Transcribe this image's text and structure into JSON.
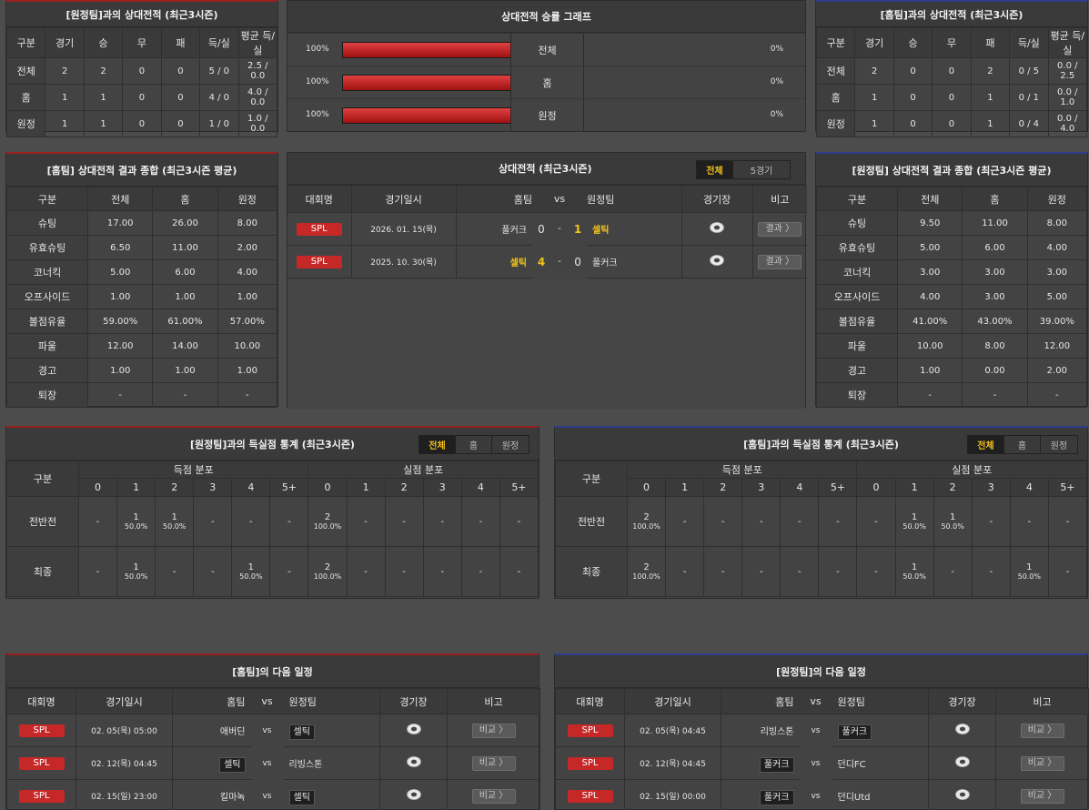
{
  "colors": {
    "accent_red": "#c62828",
    "highlight_yellow": "#f2c21a",
    "home_border": "#9a1f1f",
    "away_border": "#2d3d8a"
  },
  "h2h_left": {
    "title": "[원정팀]과의 상대전적 (최근3시즌)",
    "headers": [
      "구분",
      "경기",
      "승",
      "무",
      "패",
      "득/실",
      "평균 득/실"
    ],
    "rows": [
      [
        "전체",
        "2",
        "2",
        "0",
        "0",
        "5 / 0",
        "2.5 / 0.0"
      ],
      [
        "홈",
        "1",
        "1",
        "0",
        "0",
        "4 / 0",
        "4.0 / 0.0"
      ],
      [
        "원정",
        "1",
        "1",
        "0",
        "0",
        "1 / 0",
        "1.0 / 0.0"
      ]
    ]
  },
  "graph": {
    "title": "상대전적 승률 그래프",
    "rows": [
      {
        "left": "100%",
        "label": "전체",
        "right": "0%",
        "value": 1.0
      },
      {
        "left": "100%",
        "label": "홈",
        "right": "0%",
        "value": 1.0
      },
      {
        "left": "100%",
        "label": "원정",
        "right": "0%",
        "value": 1.0
      }
    ]
  },
  "h2h_right": {
    "title": "[홈팀]과의 상대전적 (최근3시즌)",
    "headers": [
      "구분",
      "경기",
      "승",
      "무",
      "패",
      "득/실",
      "평균 득/실"
    ],
    "rows": [
      [
        "전체",
        "2",
        "0",
        "0",
        "2",
        "0 / 5",
        "0.0 / 2.5"
      ],
      [
        "홈",
        "1",
        "0",
        "0",
        "1",
        "0 / 1",
        "0.0 / 1.0"
      ],
      [
        "원정",
        "1",
        "0",
        "0",
        "1",
        "0 / 4",
        "0.0 / 4.0"
      ]
    ]
  },
  "summary_home": {
    "title": "[홈팀] 상대전적 결과 종합 (최근3시즌 평균)",
    "headers": [
      "구분",
      "전체",
      "홈",
      "원정"
    ],
    "rows": [
      [
        "슈팅",
        "17.00",
        "26.00",
        "8.00"
      ],
      [
        "유효슈팅",
        "6.50",
        "11.00",
        "2.00"
      ],
      [
        "코너킥",
        "5.00",
        "6.00",
        "4.00"
      ],
      [
        "오프사이드",
        "1.00",
        "1.00",
        "1.00"
      ],
      [
        "볼점유율",
        "59.00%",
        "61.00%",
        "57.00%"
      ],
      [
        "파울",
        "12.00",
        "14.00",
        "10.00"
      ],
      [
        "경고",
        "1.00",
        "1.00",
        "1.00"
      ],
      [
        "퇴장",
        "-",
        "-",
        "-"
      ]
    ]
  },
  "h2h_matches": {
    "title": "상대전적 (최근3시즌)",
    "tabs": [
      "전체",
      "5경기"
    ],
    "headers": {
      "league": "대회명",
      "date": "경기일시",
      "home": "홈팀",
      "vs": "vs",
      "away": "원정팀",
      "stadium": "경기장",
      "note": "비고"
    },
    "rows": [
      {
        "league": "SPL",
        "date": "2026. 01. 15(목)",
        "home": "풀커크",
        "hs": "0",
        "sep": "-",
        "as": "1",
        "away": "셀틱",
        "btn": "결과 〉"
      },
      {
        "league": "SPL",
        "date": "2025. 10. 30(목)",
        "home": "셀틱",
        "hs": "4",
        "sep": "-",
        "as": "0",
        "away": "풀커크",
        "btn": "결과 〉"
      }
    ]
  },
  "summary_away": {
    "title": "[원정팀] 상대전적 결과 종합 (최근3시즌 평균)",
    "headers": [
      "구분",
      "전체",
      "홈",
      "원정"
    ],
    "rows": [
      [
        "슈팅",
        "9.50",
        "11.00",
        "8.00"
      ],
      [
        "유효슈팅",
        "5.00",
        "6.00",
        "4.00"
      ],
      [
        "코너킥",
        "3.00",
        "3.00",
        "3.00"
      ],
      [
        "오프사이드",
        "4.00",
        "3.00",
        "5.00"
      ],
      [
        "볼점유율",
        "41.00%",
        "43.00%",
        "39.00%"
      ],
      [
        "파울",
        "10.00",
        "8.00",
        "12.00"
      ],
      [
        "경고",
        "1.00",
        "0.00",
        "2.00"
      ],
      [
        "퇴장",
        "-",
        "-",
        "-"
      ]
    ]
  },
  "goals_left": {
    "title": "[원정팀]과의 득실점 통계 (최근3시즌)",
    "tabs": [
      "전체",
      "홈",
      "원정"
    ],
    "col_label": "구분",
    "for_label": "득점 분포",
    "against_label": "실점 분포",
    "buckets": [
      "0",
      "1",
      "2",
      "3",
      "4",
      "5+"
    ],
    "rows": [
      {
        "label": "전반전",
        "for": [
          [
            "-",
            ""
          ],
          [
            "1",
            "50.0%"
          ],
          [
            "1",
            "50.0%"
          ],
          [
            "-",
            ""
          ],
          [
            "-",
            ""
          ],
          [
            "-",
            ""
          ]
        ],
        "against": [
          [
            "2",
            "100.0%"
          ],
          [
            "-",
            ""
          ],
          [
            "-",
            ""
          ],
          [
            "-",
            ""
          ],
          [
            "-",
            ""
          ],
          [
            "-",
            ""
          ]
        ]
      },
      {
        "label": "최종",
        "for": [
          [
            "-",
            ""
          ],
          [
            "1",
            "50.0%"
          ],
          [
            "-",
            ""
          ],
          [
            "-",
            ""
          ],
          [
            "1",
            "50.0%"
          ],
          [
            "-",
            ""
          ]
        ],
        "against": [
          [
            "2",
            "100.0%"
          ],
          [
            "-",
            ""
          ],
          [
            "-",
            ""
          ],
          [
            "-",
            ""
          ],
          [
            "-",
            ""
          ],
          [
            "-",
            ""
          ]
        ]
      }
    ]
  },
  "goals_right": {
    "title": "[홈팀]과의 득실점 통계 (최근3시즌)",
    "tabs": [
      "전체",
      "홈",
      "원정"
    ],
    "col_label": "구분",
    "for_label": "득점 분포",
    "against_label": "실점 분포",
    "buckets": [
      "0",
      "1",
      "2",
      "3",
      "4",
      "5+"
    ],
    "rows": [
      {
        "label": "전반전",
        "for": [
          [
            "2",
            "100.0%"
          ],
          [
            "-",
            ""
          ],
          [
            "-",
            ""
          ],
          [
            "-",
            ""
          ],
          [
            "-",
            ""
          ],
          [
            "-",
            ""
          ]
        ],
        "against": [
          [
            "-",
            ""
          ],
          [
            "1",
            "50.0%"
          ],
          [
            "1",
            "50.0%"
          ],
          [
            "-",
            ""
          ],
          [
            "-",
            ""
          ],
          [
            "-",
            ""
          ]
        ]
      },
      {
        "label": "최종",
        "for": [
          [
            "2",
            "100.0%"
          ],
          [
            "-",
            ""
          ],
          [
            "-",
            ""
          ],
          [
            "-",
            ""
          ],
          [
            "-",
            ""
          ],
          [
            "-",
            ""
          ]
        ],
        "against": [
          [
            "-",
            ""
          ],
          [
            "1",
            "50.0%"
          ],
          [
            "-",
            ""
          ],
          [
            "-",
            ""
          ],
          [
            "1",
            "50.0%"
          ],
          [
            "-",
            ""
          ]
        ]
      }
    ]
  },
  "next_home": {
    "title": "[홈팀]의 다음 일정",
    "headers": {
      "league": "대회명",
      "date": "경기일시",
      "home": "홈팀",
      "vs": "vs",
      "away": "원정팀",
      "stadium": "경기장",
      "note": "비고"
    },
    "rows": [
      {
        "league": "SPL",
        "date": "02. 05(목) 05:00",
        "home": "애버딘",
        "vs": "vs",
        "away": "셀틱",
        "hl": "away",
        "btn": "비교 〉"
      },
      {
        "league": "SPL",
        "date": "02. 12(목) 04:45",
        "home": "셀틱",
        "vs": "vs",
        "away": "리빙스톤",
        "hl": "home",
        "btn": "비교 〉"
      },
      {
        "league": "SPL",
        "date": "02. 15(일) 23:00",
        "home": "킬마녹",
        "vs": "vs",
        "away": "셀틱",
        "hl": "away",
        "btn": "비교 〉"
      }
    ]
  },
  "next_away": {
    "title": "[원정팀]의 다음 일정",
    "headers": {
      "league": "대회명",
      "date": "경기일시",
      "home": "홈팀",
      "vs": "vs",
      "away": "원정팀",
      "stadium": "경기장",
      "note": "비고"
    },
    "rows": [
      {
        "league": "SPL",
        "date": "02. 05(목) 04:45",
        "home": "리빙스톤",
        "vs": "vs",
        "away": "풀커크",
        "hl": "away",
        "btn": "비교 〉"
      },
      {
        "league": "SPL",
        "date": "02. 12(목) 04:45",
        "home": "풀커크",
        "vs": "vs",
        "away": "던디FC",
        "hl": "home",
        "btn": "비교 〉"
      },
      {
        "league": "SPL",
        "date": "02. 15(일) 00:00",
        "home": "풀커크",
        "vs": "vs",
        "away": "던디Utd",
        "hl": "home",
        "btn": "비교 〉"
      }
    ]
  }
}
